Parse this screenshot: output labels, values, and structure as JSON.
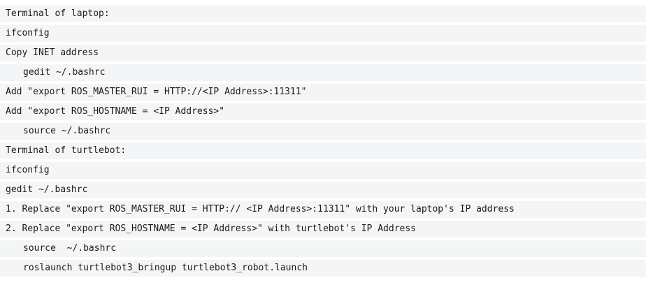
{
  "lines": [
    {
      "text": "Terminal of laptop:",
      "indent": 0
    },
    {
      "text": "ifconfig",
      "indent": 0
    },
    {
      "text": "Copy INET address",
      "indent": 0
    },
    {
      "text": "gedit ~/.bashrc",
      "indent": 1
    },
    {
      "text": "Add \"export ROS_MASTER_RUI = HTTP://<IP Address>:11311\"",
      "indent": 0
    },
    {
      "text": "Add \"export ROS_HOSTNAME = <IP Address>\"",
      "indent": 0
    },
    {
      "text": "source ~/.bashrc",
      "indent": 1
    },
    {
      "text": "Terminal of turtlebot:",
      "indent": 0
    },
    {
      "text": "ifconfig",
      "indent": 0
    },
    {
      "text": "gedit ~/.bashrc",
      "indent": 0
    },
    {
      "text": "1. Replace \"export ROS_MASTER_RUI = HTTP:// <IP Address>:11311\" with your laptop's IP address",
      "indent": 0
    },
    {
      "text": "2. Replace \"export ROS_HOSTNAME = <IP Address>\" with turtlebot's IP Address",
      "indent": 0
    },
    {
      "text": "source  ~/.bashrc",
      "indent": 1
    },
    {
      "text": "roslaunch turtlebot3_bringup turtlebot3_robot.launch",
      "indent": 1
    }
  ]
}
